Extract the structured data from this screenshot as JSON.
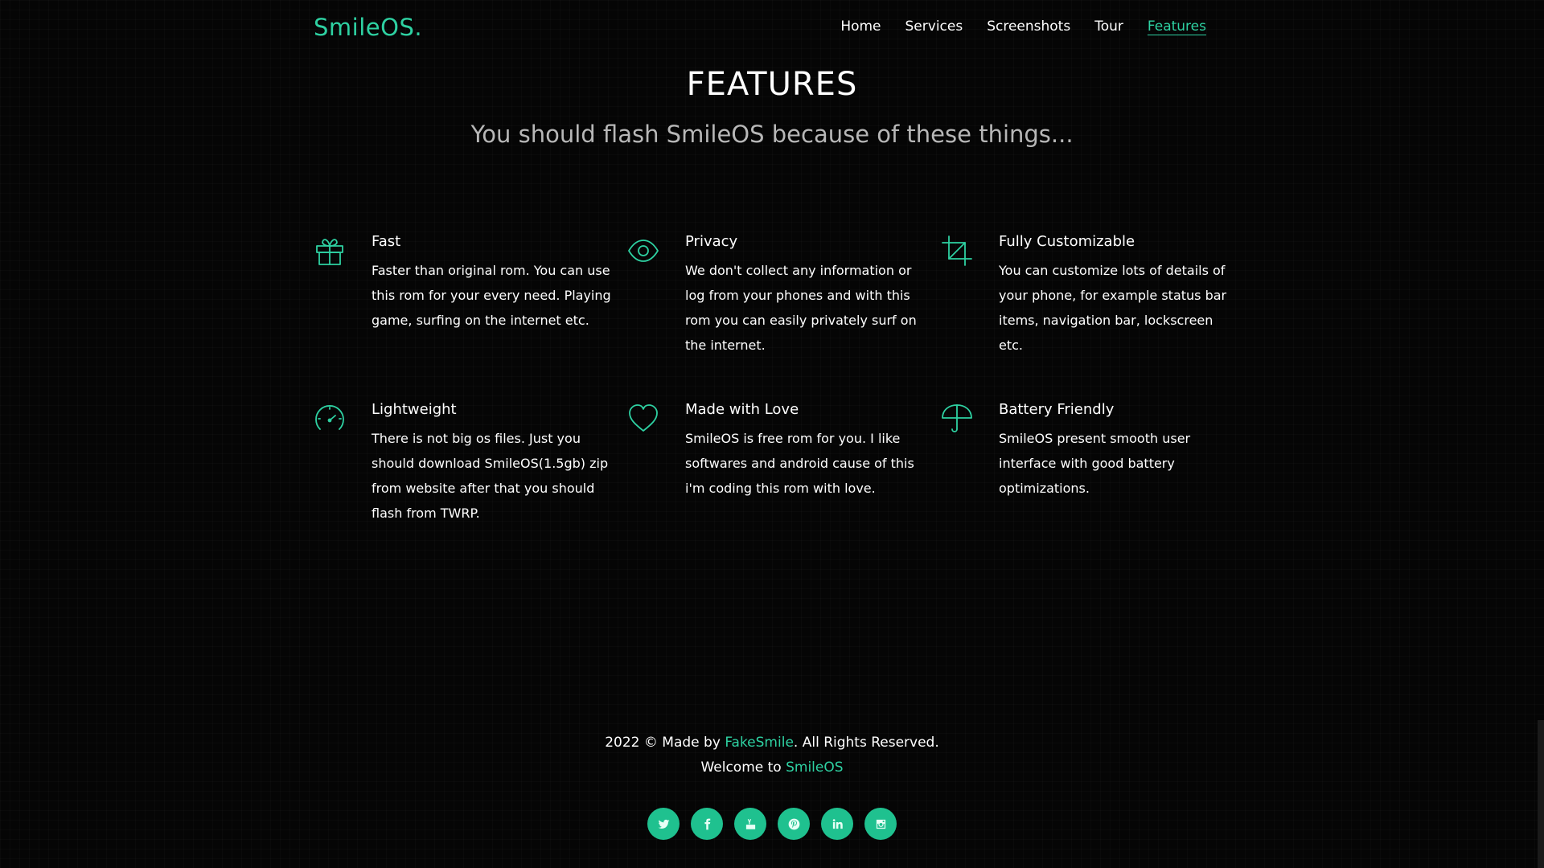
{
  "nav": {
    "brand": "SmileOS.",
    "links": [
      {
        "label": "Home"
      },
      {
        "label": "Services"
      },
      {
        "label": "Screenshots"
      },
      {
        "label": "Tour"
      },
      {
        "label": "Features",
        "active": true
      }
    ]
  },
  "hero": {
    "title": "FEATURES",
    "subtitle": "You should flash SmileOS because of these things..."
  },
  "features": [
    {
      "icon": "gift-icon",
      "title": "Fast",
      "desc": "Faster than original rom. You can use this rom for your every need. Playing game, surfing on the internet etc."
    },
    {
      "icon": "eye-icon",
      "title": "Privacy",
      "desc": "We don't collect any information or log from your phones and with this rom you can easily privately surf on the internet."
    },
    {
      "icon": "crop-icon",
      "title": "Fully Customizable",
      "desc": "You can customize lots of details of your phone, for example status bar items, navigation bar, lockscreen etc."
    },
    {
      "icon": "speedometer-icon",
      "title": "Lightweight",
      "desc": "There is not big os files. Just you should download SmileOS(1.5gb) zip from website after that you should flash from TWRP."
    },
    {
      "icon": "heart-icon",
      "title": "Made with Love",
      "desc": "SmileOS is free rom for you. I like softwares and android cause of this i'm coding this rom with love."
    },
    {
      "icon": "umbrella-icon",
      "title": "Battery Friendly",
      "desc": "SmileOS present smooth user interface with good battery optimizations."
    }
  ],
  "footer": {
    "copyright_prefix": "2022 © Made by ",
    "author": "FakeSmile",
    "copyright_suffix": ". All Rights Reserved.",
    "welcome_prefix": "Welcome to ",
    "welcome_link": "SmileOS",
    "social": [
      "twitter-icon",
      "facebook-icon",
      "youtube-icon",
      "pinterest-icon",
      "linkedin-icon",
      "instagram-icon"
    ]
  },
  "colors": {
    "accent": "#2ed1a2",
    "background": "#050505",
    "social_bg": "#1fc18f"
  }
}
